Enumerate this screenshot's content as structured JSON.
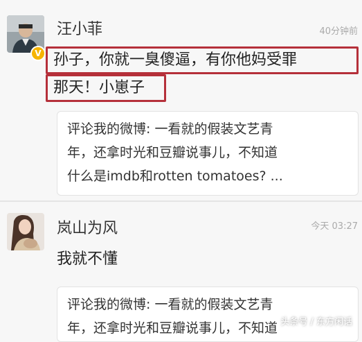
{
  "comments": [
    {
      "username": "汪小菲",
      "time": "40分钟前",
      "verified": true,
      "text_lines": [
        "孙子，你就一臭傻逼，有你他妈受罪",
        "那天！小崽子"
      ],
      "quote_lines": [
        "评论我的微博: 一看就的假装文艺青",
        "年，还拿时光和豆瓣说事儿，不知道",
        "什么是imdb和rotten tomatoes?  ..."
      ]
    },
    {
      "username": "岚山为风",
      "time": "今天 03:27",
      "text_lines": [
        "我就不懂"
      ],
      "quote_lines": [
        "评论我的微博: 一看就的假装文艺青",
        "年，还拿时光和豆瓣说事儿，不知道"
      ]
    }
  ],
  "watermark": "头条号 / 东方闲话"
}
